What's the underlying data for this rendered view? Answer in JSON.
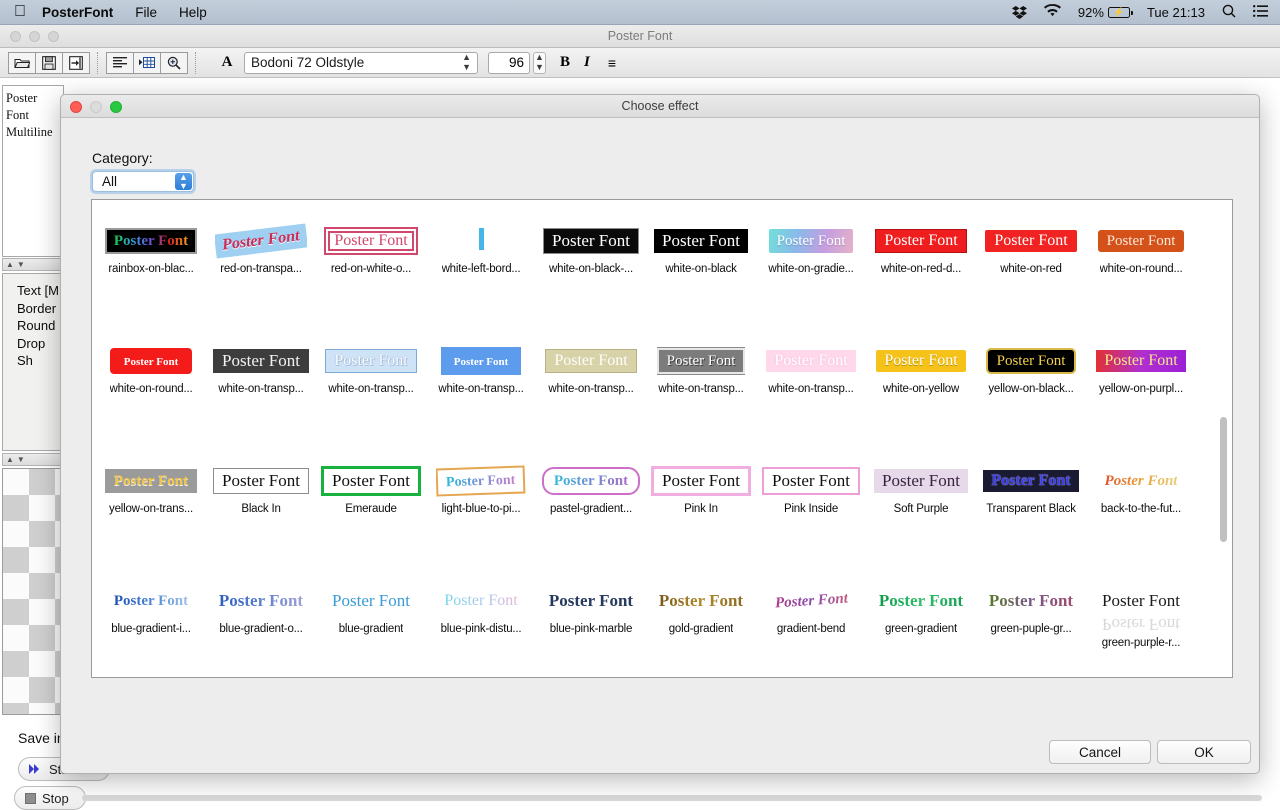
{
  "menubar": {
    "apple_icon": "apple-icon",
    "app_name": "PosterFont",
    "menus": [
      "File",
      "Help"
    ],
    "status": {
      "dropbox_icon": "dropbox-icon",
      "wifi_icon": "wifi-icon",
      "battery_percent": "92%",
      "battery_icon": "battery-charging-icon",
      "clock": "Tue 21:13",
      "search_icon": "spotlight-search-icon",
      "list_icon": "notification-center-icon"
    }
  },
  "window": {
    "title": "Poster Font",
    "toolbar": {
      "open_icon": "open-folder-icon",
      "save_icon": "save-disk-icon",
      "export_icon": "export-icon",
      "align_icon": "align-text-icon",
      "table_icon": "insert-table-icon",
      "zoom_icon": "zoom-magnifier-icon",
      "font_glyph": "A",
      "font_name": "Bodoni 72 Oldstyle",
      "font_size": "96",
      "bold_label": "B",
      "italic_label": "I",
      "align_label": "≡"
    },
    "text_panel": {
      "line1": "Poster Font",
      "line2": "Multiline"
    },
    "effect_list": [
      "Text [M",
      "Border",
      "Round",
      "Drop Sh"
    ],
    "save_in_label": "Save in",
    "start_button": "Sta",
    "start_icon": "play-forward-icon",
    "stop_button": "Stop",
    "stop_icon": "stop-square-icon"
  },
  "dialog": {
    "title": "Choose effect",
    "category_label": "Category:",
    "category_value": "All",
    "cancel_label": "Cancel",
    "ok_label": "OK",
    "effects": [
      {
        "caption": "rainbox-on-blac...",
        "text": "Poster Font",
        "style": "rainbow-on-black"
      },
      {
        "caption": "red-on-transpa...",
        "text": "Poster Font",
        "style": "red-on-transparent"
      },
      {
        "caption": "red-on-white-o...",
        "text": "Poster Font",
        "style": "red-on-white-outline"
      },
      {
        "caption": "white-left-bord...",
        "text": "",
        "style": "white-left-border"
      },
      {
        "caption": "white-on-black-...",
        "text": "Poster Font",
        "style": "white-on-black-bold"
      },
      {
        "caption": "white-on-black",
        "text": "Poster Font",
        "style": "white-on-black"
      },
      {
        "caption": "white-on-gradie...",
        "text": "Poster Font",
        "style": "white-on-gradient"
      },
      {
        "caption": "white-on-red-d...",
        "text": "Poster Font",
        "style": "white-on-red-dark"
      },
      {
        "caption": "white-on-red",
        "text": "Poster Font",
        "style": "white-on-red"
      },
      {
        "caption": "white-on-round...",
        "text": "Poster Font",
        "style": "white-on-round-orange"
      },
      {
        "caption": "white-on-round...",
        "text": "Poster Font",
        "style": "white-on-round-red"
      },
      {
        "caption": "white-on-transp...",
        "text": "Poster Font",
        "style": "white-on-transp-dark"
      },
      {
        "caption": "white-on-transp...",
        "text": "Poster Font",
        "style": "white-on-transp-lightblue"
      },
      {
        "caption": "white-on-transp...",
        "text": "Poster Font",
        "style": "white-on-transp-blue"
      },
      {
        "caption": "white-on-transp...",
        "text": "Poster Font",
        "style": "white-on-transp-cream"
      },
      {
        "caption": "white-on-transp...",
        "text": "Poster Font",
        "style": "white-on-transp-grey"
      },
      {
        "caption": "white-on-transp...",
        "text": "Poster Font",
        "style": "white-on-transp-pink"
      },
      {
        "caption": "white-on-yellow",
        "text": "Poster Font",
        "style": "white-on-yellow"
      },
      {
        "caption": "yellow-on-black...",
        "text": "Poster Font",
        "style": "yellow-on-black"
      },
      {
        "caption": "yellow-on-purpl...",
        "text": "Poster Font",
        "style": "yellow-on-purple"
      },
      {
        "caption": "yellow-on-trans...",
        "text": "Poster Font",
        "style": "yellow-on-transparent"
      },
      {
        "caption": "Black In",
        "text": "Poster Font",
        "style": "black-in"
      },
      {
        "caption": "Emeraude",
        "text": "Poster Font",
        "style": "emeraude"
      },
      {
        "caption": "light-blue-to-pi...",
        "text": "Poster Font",
        "style": "light-blue-to-pink"
      },
      {
        "caption": "pastel-gradient...",
        "text": "Poster Font",
        "style": "pastel-gradient"
      },
      {
        "caption": "Pink In",
        "text": "Poster Font",
        "style": "pink-in"
      },
      {
        "caption": "Pink Inside",
        "text": "Poster Font",
        "style": "pink-inside"
      },
      {
        "caption": "Soft Purple",
        "text": "Poster Font",
        "style": "soft-purple"
      },
      {
        "caption": "Transparent Black",
        "text": "Poster Font",
        "style": "transparent-black"
      },
      {
        "caption": "back-to-the-fut...",
        "text": "Poster Font",
        "style": "back-to-the-future"
      },
      {
        "caption": "blue-gradient-i...",
        "text": "Poster Font",
        "style": "blue-gradient-in"
      },
      {
        "caption": "blue-gradient-o...",
        "text": "Poster Font",
        "style": "blue-gradient-out"
      },
      {
        "caption": "blue-gradient",
        "text": "Poster Font",
        "style": "blue-gradient"
      },
      {
        "caption": "blue-pink-distu...",
        "text": "Poster Font",
        "style": "blue-pink-disturbed"
      },
      {
        "caption": "blue-pink-marble",
        "text": "Poster Font",
        "style": "blue-pink-marble"
      },
      {
        "caption": "gold-gradient",
        "text": "Poster Font",
        "style": "gold-gradient"
      },
      {
        "caption": "gradient-bend",
        "text": "Poster Font",
        "style": "gradient-bend"
      },
      {
        "caption": "green-gradient",
        "text": "Poster Font",
        "style": "green-gradient"
      },
      {
        "caption": "green-puple-gr...",
        "text": "Poster Font",
        "style": "green-purple-gradient"
      },
      {
        "caption": "green-purple-r...",
        "text": "Poster Font",
        "style": "green-purple-reflect"
      }
    ]
  },
  "colors": {
    "menubar_bg": "#b9c5d3",
    "dialog_bg": "#ededed",
    "accent_blue": "#2d7ed6",
    "traffic_red": "#ff5f57",
    "traffic_green": "#28c840"
  }
}
